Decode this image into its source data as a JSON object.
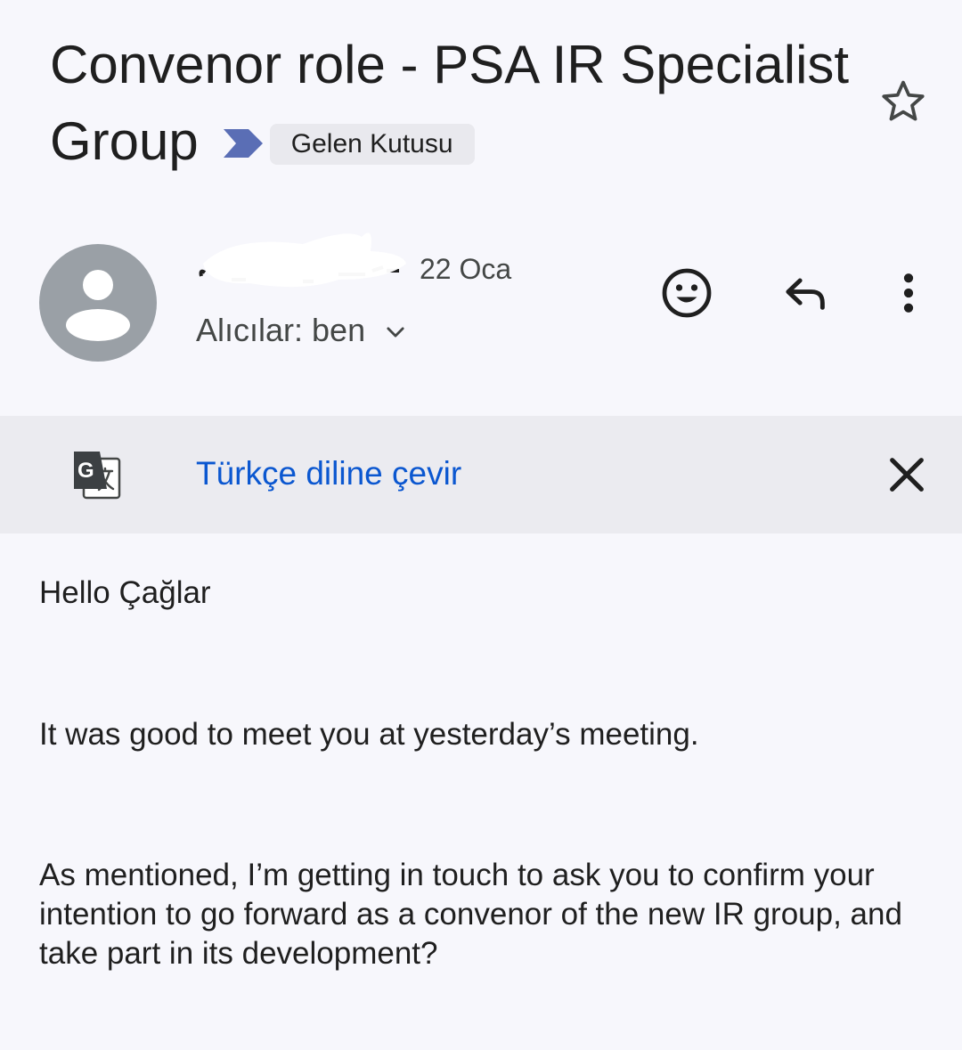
{
  "email": {
    "subject": "Convenor role - PSA IR Specialist Group",
    "label": "Gelen Kutusu",
    "date": "22 Oca",
    "recipients_label": "Alıcılar: ben",
    "translate": {
      "link_text": "Türkçe diline çevir"
    },
    "body": {
      "greeting": "Hello Çağlar",
      "paragraph_1": "It was good to meet you at yesterday’s meeting.",
      "paragraph_2": "As mentioned, I’m getting in touch to ask you to confirm your intention to go forward as a convenor of the new IR group, and take part in its development?"
    }
  },
  "icons": {
    "important_marker": "important-marker-icon",
    "star": "star-outline-icon",
    "avatar": "person-avatar-icon",
    "expand": "chevron-down-icon",
    "emoji": "add-emoji-icon",
    "reply": "reply-icon",
    "more": "more-vert-icon",
    "translate": "translate-icon",
    "close": "close-icon"
  },
  "colors": {
    "background": "#f7f7fc",
    "translate_bar": "#ebebf0",
    "link": "#0b57d0",
    "important_marker": "#5a6eb5",
    "avatar": "#9aa0a6",
    "label_chip": "#e9e9ee"
  }
}
